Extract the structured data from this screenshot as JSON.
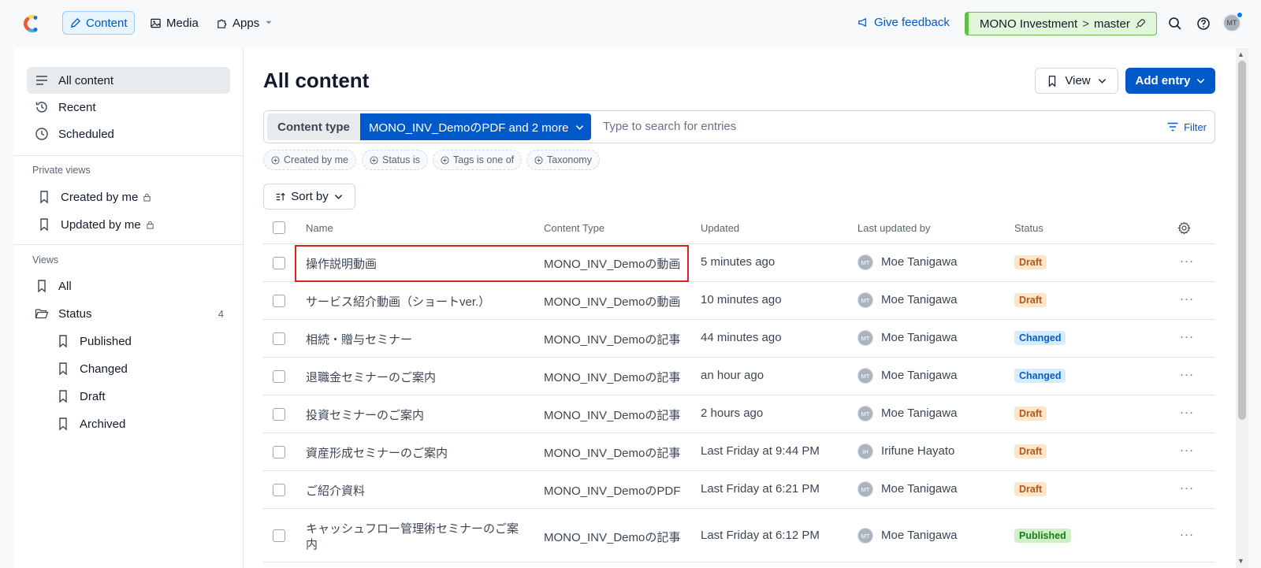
{
  "topnav": {
    "items": [
      {
        "label": "Content",
        "icon": "pen-icon"
      },
      {
        "label": "Media",
        "icon": "image-icon"
      },
      {
        "label": "Apps",
        "icon": "puzzle-icon"
      }
    ],
    "feedback": "Give feedback",
    "environment": {
      "space": "MONO Investment",
      "separator": ">",
      "branch": "master"
    },
    "avatar": "MT"
  },
  "sidebar": {
    "main": [
      {
        "label": "All content",
        "icon": "list-icon"
      },
      {
        "label": "Recent",
        "icon": "history-icon"
      },
      {
        "label": "Scheduled",
        "icon": "clock-icon"
      }
    ],
    "private_views_heading": "Private views",
    "private_views": [
      {
        "label": "Created by me",
        "icon": "bookmark-icon"
      },
      {
        "label": "Updated by me",
        "icon": "bookmark-icon"
      }
    ],
    "views_heading": "Views",
    "views": [
      {
        "label": "All"
      },
      {
        "label": "Status",
        "count": "4"
      }
    ],
    "status_views": [
      {
        "label": "Published"
      },
      {
        "label": "Changed"
      },
      {
        "label": "Draft"
      },
      {
        "label": "Archived"
      }
    ]
  },
  "main": {
    "title": "All content",
    "view_btn": "View",
    "add_btn": "Add entry",
    "search": {
      "content_type_label": "Content type",
      "content_type_value": "MONO_INV_DemoのPDF and 2 more",
      "placeholder": "Type to search for entries",
      "filter_label": "Filter"
    },
    "quick_filters": [
      "Created by me",
      "Status is",
      "Tags is one of",
      "Taxonomy"
    ],
    "sort_label": "Sort by",
    "columns": [
      "Name",
      "Content Type",
      "Updated",
      "Last updated by",
      "Status"
    ],
    "rows": [
      {
        "name": "操作説明動画",
        "type": "MONO_INV_Demoの動画",
        "updated": "5 minutes ago",
        "user": "Moe Tanigawa",
        "initials": "MT",
        "status": "Draft"
      },
      {
        "name": "サービス紹介動画（ショートver.）",
        "type": "MONO_INV_Demoの動画",
        "updated": "10 minutes ago",
        "user": "Moe Tanigawa",
        "initials": "MT",
        "status": "Draft"
      },
      {
        "name": "相続・贈与セミナー",
        "type": "MONO_INV_Demoの記事",
        "updated": "44 minutes ago",
        "user": "Moe Tanigawa",
        "initials": "MT",
        "status": "Changed"
      },
      {
        "name": "退職金セミナーのご案内",
        "type": "MONO_INV_Demoの記事",
        "updated": "an hour ago",
        "user": "Moe Tanigawa",
        "initials": "MT",
        "status": "Changed"
      },
      {
        "name": "投資セミナーのご案内",
        "type": "MONO_INV_Demoの記事",
        "updated": "2 hours ago",
        "user": "Moe Tanigawa",
        "initials": "MT",
        "status": "Draft"
      },
      {
        "name": "資産形成セミナーのご案内",
        "type": "MONO_INV_Demoの記事",
        "updated": "Last Friday at 9:44 PM",
        "user": "Irifune Hayato",
        "initials": "IH",
        "status": "Draft"
      },
      {
        "name": "ご紹介資料",
        "type": "MONO_INV_DemoのPDF",
        "updated": "Last Friday at 6:21 PM",
        "user": "Moe Tanigawa",
        "initials": "MT",
        "status": "Draft"
      },
      {
        "name": "キャッシュフロー管理術セミナーのご案内",
        "type": "MONO_INV_Demoの記事",
        "updated": "Last Friday at 6:12 PM",
        "user": "Moe Tanigawa",
        "initials": "MT",
        "status": "Published"
      }
    ]
  }
}
